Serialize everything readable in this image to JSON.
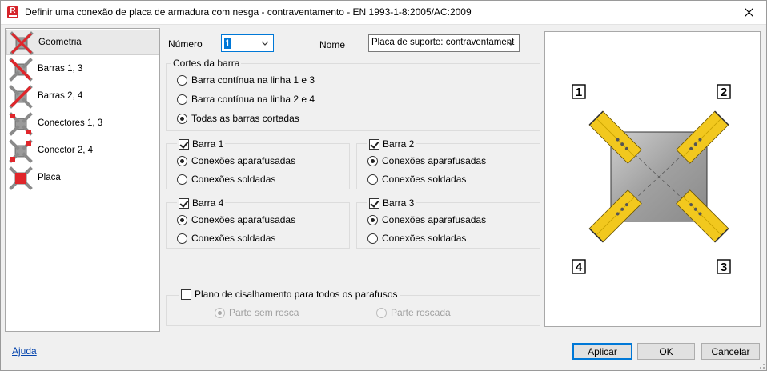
{
  "window": {
    "title": "Definir uma conexão de placa de armadura com nesga - contraventamento  - EN 1993-1-8:2005/AC:2009",
    "app_icon_letter": "R"
  },
  "sidebar": {
    "items": [
      {
        "label": "Geometria",
        "icon": "brace-geometry-icon",
        "selected": true
      },
      {
        "label": "Barras 1, 3",
        "icon": "brace-bars-icon"
      },
      {
        "label": "Barras 2, 4",
        "icon": "brace-bars-icon"
      },
      {
        "label": "Conectores 1, 3",
        "icon": "brace-connectors-icon"
      },
      {
        "label": "Conector 2, 4",
        "icon": "brace-connectors-icon"
      },
      {
        "label": "Placa",
        "icon": "plate-icon"
      }
    ]
  },
  "form": {
    "numero_label": "Número",
    "numero_value": "1",
    "nome_label": "Nome",
    "nome_value": "Placa de suporte: contraventament"
  },
  "cortes": {
    "title": "Cortes da barra",
    "options": [
      {
        "label": "Barra contínua na linha 1 e 3",
        "selected": false
      },
      {
        "label": "Barra contínua na linha 2 e 4",
        "selected": false
      },
      {
        "label": "Todas as barras cortadas",
        "selected": true
      }
    ]
  },
  "bar_groups": [
    {
      "title": "Barra 1",
      "checked": true,
      "opt1": "Conexões aparafusadas",
      "opt2": "Conexões soldadas",
      "selected": 1
    },
    {
      "title": "Barra 2",
      "checked": true,
      "opt1": "Conexões aparafusadas",
      "opt2": "Conexões soldadas",
      "selected": 1
    },
    {
      "title": "Barra 4",
      "checked": true,
      "opt1": "Conexões aparafusadas",
      "opt2": "Conexões soldadas",
      "selected": 1
    },
    {
      "title": "Barra 3",
      "checked": true,
      "opt1": "Conexões aparafusadas",
      "opt2": "Conexões soldadas",
      "selected": 1
    }
  ],
  "shear": {
    "title": "Plano de cisalhamento para todos os parafusos",
    "checked": false,
    "opt1": "Parte sem rosca",
    "opt2": "Parte roscada"
  },
  "preview": {
    "labels": [
      "1",
      "2",
      "3",
      "4"
    ],
    "bar_color": "#f2c81e",
    "plate_color": "#a9a9a9"
  },
  "buttons": {
    "help": "Ajuda",
    "apply": "Aplicar",
    "ok": "OK",
    "cancel": "Cancelar"
  },
  "colors": {
    "accent": "#0078d7",
    "red_cross": "#e0262b"
  }
}
